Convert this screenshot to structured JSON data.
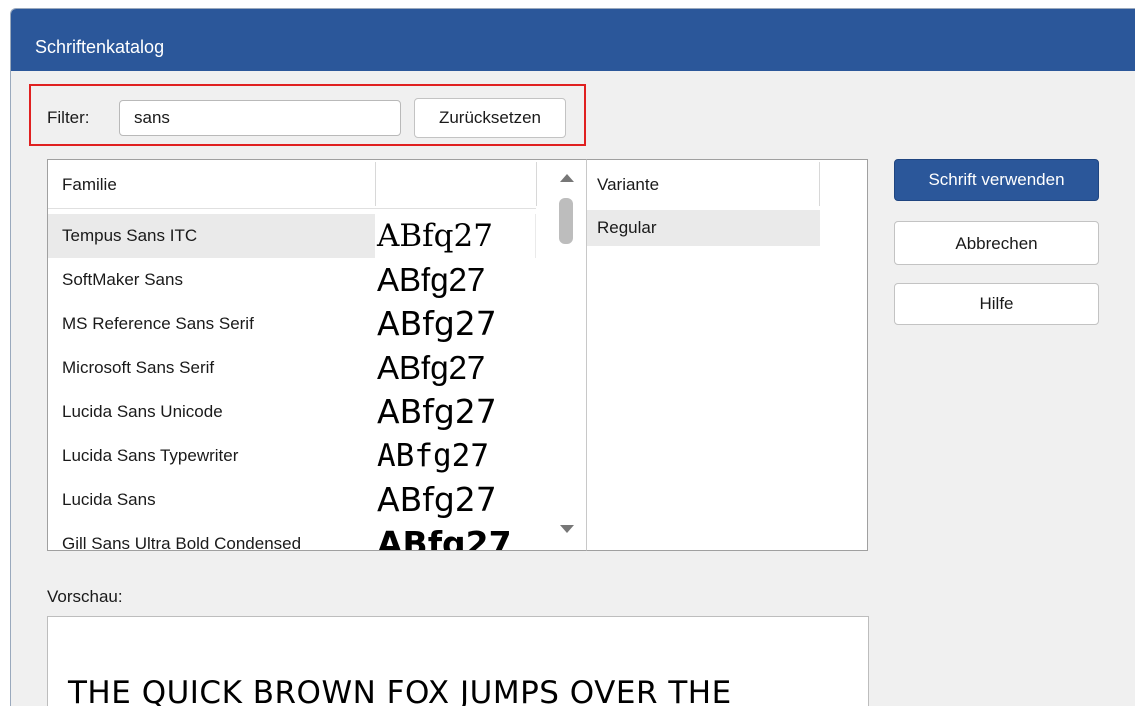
{
  "window": {
    "title": "Schriftenkatalog"
  },
  "filter": {
    "label": "Filter:",
    "value": "sans",
    "reset_label": "Zurücksetzen"
  },
  "buttons": {
    "use": "Schrift verwenden",
    "cancel": "Abbrechen",
    "help": "Hilfe"
  },
  "family_list": {
    "header": "Familie",
    "rows": [
      {
        "name": "Tempus Sans ITC",
        "sample": "ABfq27"
      },
      {
        "name": "SoftMaker Sans",
        "sample": "ABfg27"
      },
      {
        "name": "MS Reference Sans Serif",
        "sample": "ABfg27"
      },
      {
        "name": "Microsoft Sans Serif",
        "sample": "ABfg27"
      },
      {
        "name": "Lucida Sans Unicode",
        "sample": "ABfg27"
      },
      {
        "name": "Lucida Sans Typewriter",
        "sample": "ABfg27"
      },
      {
        "name": "Lucida Sans",
        "sample": "ABfg27"
      },
      {
        "name": "Gill Sans Ultra Bold Condensed",
        "sample": "ABfg27"
      }
    ]
  },
  "variant_list": {
    "header": "Variante",
    "rows": [
      "Regular"
    ]
  },
  "preview": {
    "label": "Vorschau:",
    "text": "THE QUICK BROWN FOX JUMPS OVER THE"
  },
  "colors": {
    "titlebar": "#2b579a",
    "highlight": "#e02020"
  }
}
